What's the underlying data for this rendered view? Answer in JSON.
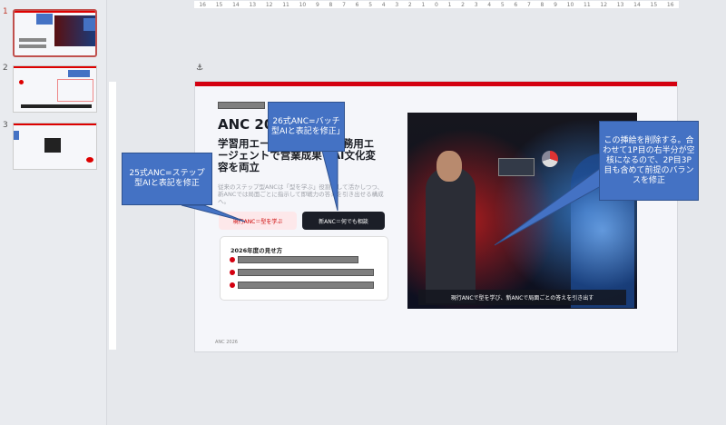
{
  "thumbnails": [
    {
      "number": "1",
      "active": true
    },
    {
      "number": "2",
      "active": false
    },
    {
      "number": "3",
      "active": false
    }
  ],
  "ruler": {
    "labels": [
      "16",
      "15",
      "14",
      "13",
      "12",
      "11",
      "10",
      "9",
      "8",
      "7",
      "6",
      "5",
      "4",
      "3",
      "2",
      "1",
      "0",
      "1",
      "2",
      "3",
      "4",
      "5",
      "6",
      "7",
      "8",
      "9",
      "10",
      "11",
      "12",
      "13",
      "14",
      "15",
      "16"
    ]
  },
  "slide": {
    "title": "ANC 2026",
    "subtitle": "学習用エージェントから実務用エージェントで営業成果とAI文化変容を両立",
    "body": "従来のステップ型ANCは「型を学ぶ」役割として活かしつつ、新ANCでは局面ごとに指示して即戦力の答えを引き出せる構成へ。",
    "btn_current": "現行ANC＝型を学ぶ",
    "btn_new": "新ANC＝何でも相談",
    "card_title": "2026年度の見せ方",
    "photo_caption": "現行ANCで型を学び、新ANCで局面ごとの答えを引き出す",
    "footer": "ANC 2026"
  },
  "callouts": {
    "c1": "25式ANC=ステップ型AIと表記を修正",
    "c2": "26式ANC=バッチ型AIと表記を修正」",
    "c3": "この挿絵を削除する。合わせて1P目の右半分が空核になるので、2P目3P目も含めて前提のバランスを修正"
  },
  "colors": {
    "accent": "#d40010",
    "callout": "#4472c4"
  }
}
